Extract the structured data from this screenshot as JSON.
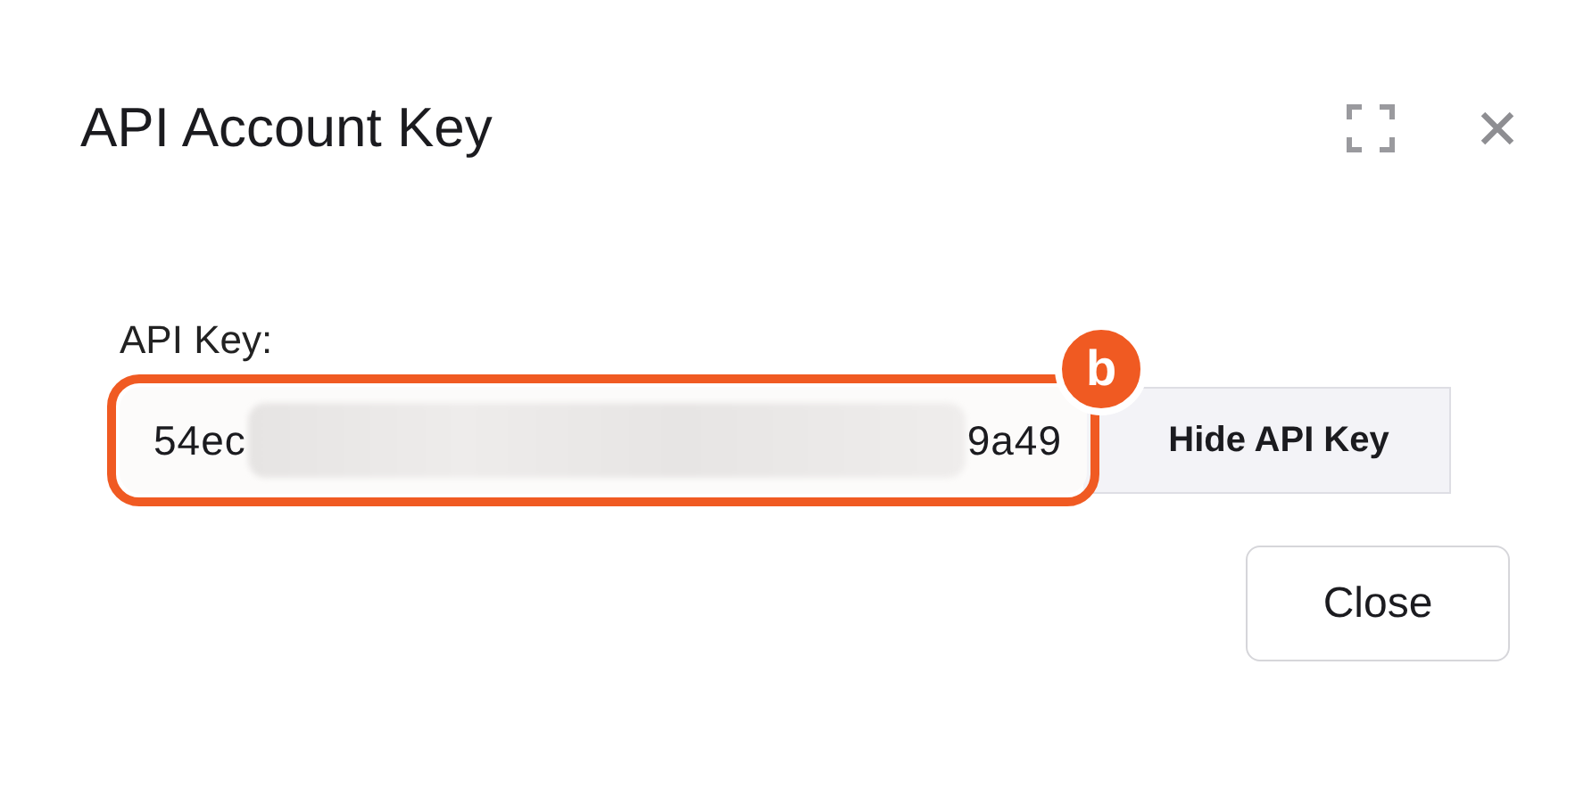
{
  "dialog": {
    "title": "API Account Key",
    "field_label": "API Key:",
    "api_key": {
      "start": "54ec",
      "end": "9a49",
      "redacted": true
    },
    "annotation": {
      "label": "b",
      "color": "#f05a22"
    },
    "toggle_button": "Hide API Key",
    "close_button": "Close"
  }
}
